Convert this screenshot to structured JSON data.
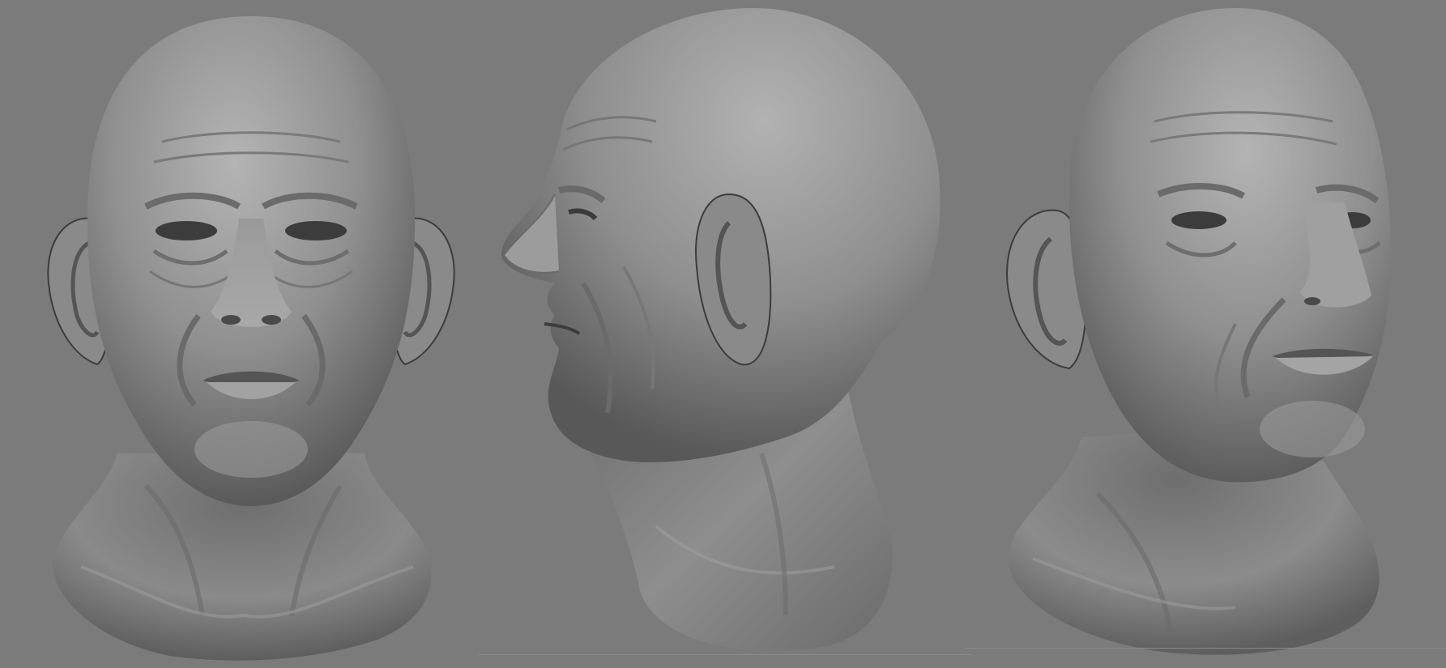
{
  "scene": {
    "background_color": "#7b7b7b",
    "skin_base_color": "#8c8c8c",
    "skin_highlight_color": "#b4b4b4",
    "skin_shadow_color": "#3c3c3c",
    "views": [
      {
        "id": "front",
        "icon": "head-front-view-icon"
      },
      {
        "id": "profile",
        "icon": "head-left-profile-view-icon"
      },
      {
        "id": "three-quarter",
        "icon": "head-three-quarter-view-icon"
      }
    ]
  }
}
